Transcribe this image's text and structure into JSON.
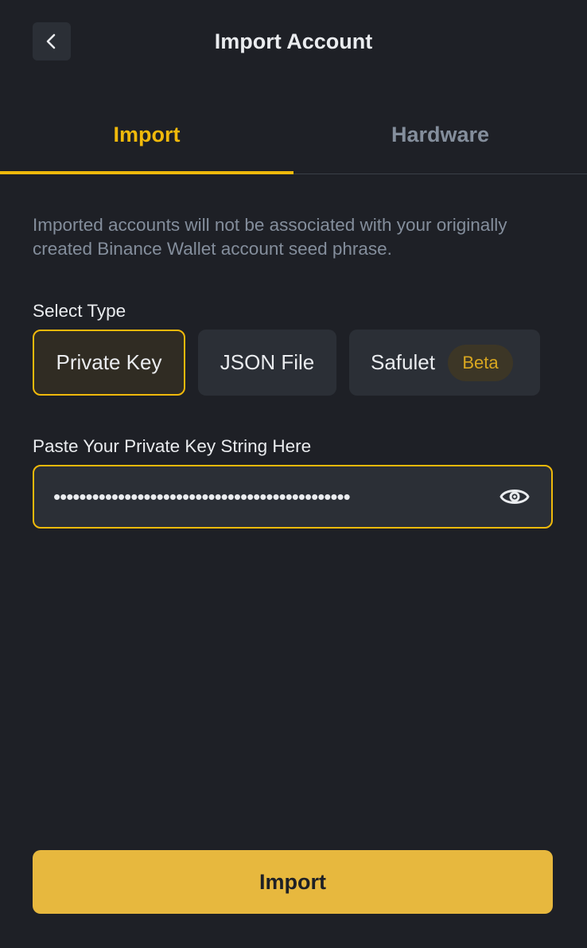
{
  "header": {
    "title": "Import Account",
    "back_icon": "chevron-left-icon"
  },
  "tabs": [
    {
      "label": "Import",
      "active": true
    },
    {
      "label": "Hardware",
      "active": false
    }
  ],
  "notice": "Imported accounts will not be associated with your originally created Binance Wallet account seed phrase.",
  "select_type": {
    "label": "Select Type",
    "options": [
      {
        "label": "Private Key",
        "selected": true
      },
      {
        "label": "JSON File",
        "selected": false
      },
      {
        "label": "Safulet",
        "badge": "Beta",
        "selected": false
      }
    ]
  },
  "private_key": {
    "label": "Paste Your Private Key String Here",
    "masked_value": "••••••••••••••••••••••••••••••••••••••••••••••",
    "toggle_icon": "eye-icon"
  },
  "footer": {
    "import_label": "Import"
  },
  "colors": {
    "background": "#1e2026",
    "surface": "#2b2f36",
    "accent": "#f0b90b",
    "button": "#e7b83e",
    "muted_text": "#848e9c"
  }
}
